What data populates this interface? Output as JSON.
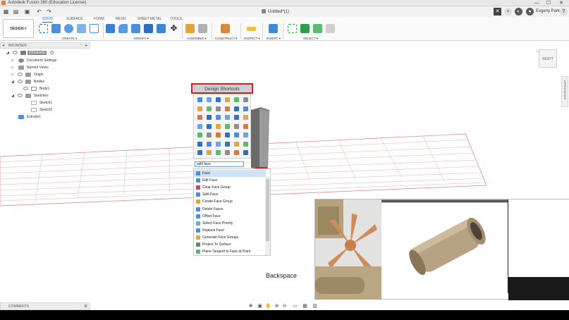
{
  "window": {
    "title": "Autodesk Fusion 360 (Education License)",
    "controls": [
      "—",
      "☐",
      "✕"
    ]
  },
  "quick_access": {
    "icons": [
      "grid-icon",
      "save-icon",
      "undo-icon",
      "redo-icon"
    ],
    "document_tab": "Untitled*(1)",
    "user": "Evgeny Park"
  },
  "ribbon": {
    "workspace": "DESIGN ▾",
    "tabs": [
      "SOLID",
      "SURFACE",
      "FORM",
      "MESH",
      "SHEET METAL",
      "TOOLS"
    ],
    "active_tab": "SOLID",
    "groups": [
      "CREATE ▾",
      "MODIFY ▾",
      "ASSEMBLE ▾",
      "CONSTRUCT ▾",
      "INSPECT ▾",
      "INSERT ▾",
      "SELECT ▾"
    ]
  },
  "browser": {
    "header": "BROWSER",
    "items": [
      {
        "label": "(Unsaved)",
        "level": 0,
        "arrow": "◢"
      },
      {
        "label": "Document Settings",
        "level": 1,
        "arrow": "▷"
      },
      {
        "label": "Named Views",
        "level": 1,
        "arrow": "▷"
      },
      {
        "label": "Origin",
        "level": 1,
        "arrow": "▷"
      },
      {
        "label": "Bodies",
        "level": 1,
        "arrow": "◢"
      },
      {
        "label": "Body1",
        "level": 2,
        "arrow": ""
      },
      {
        "label": "Sketches",
        "level": 1,
        "arrow": "◢"
      },
      {
        "label": "Sketch1",
        "level": 2,
        "arrow": ""
      },
      {
        "label": "Sketch2",
        "level": 2,
        "arrow": ""
      },
      {
        "label": "Extrude1",
        "level": 1,
        "arrow": ""
      }
    ]
  },
  "viewcube": {
    "face": "RIGHT"
  },
  "side_panel": {
    "label": "APPEARANCE"
  },
  "shortcuts": {
    "title": "Design Shortcuts",
    "search_value": "split face",
    "results": [
      "Face",
      "Edit Face",
      "Clear Face Group",
      "Split Face",
      "Create Face Group",
      "Delete Faces",
      "Offset Face",
      "Select Face Priority",
      "Replace Face",
      "Generate Face Groups",
      "Project To Surface",
      "Plane Tangent to Face at Point"
    ],
    "selected_index": 0
  },
  "overlay": {
    "caption": "Backspace"
  },
  "comments": {
    "label": "COMMENTS"
  },
  "colors": {
    "accent": "#1b6ac9",
    "highlight": "#d61f26",
    "selection": "#cfe3f7",
    "grid": "#d98080"
  }
}
